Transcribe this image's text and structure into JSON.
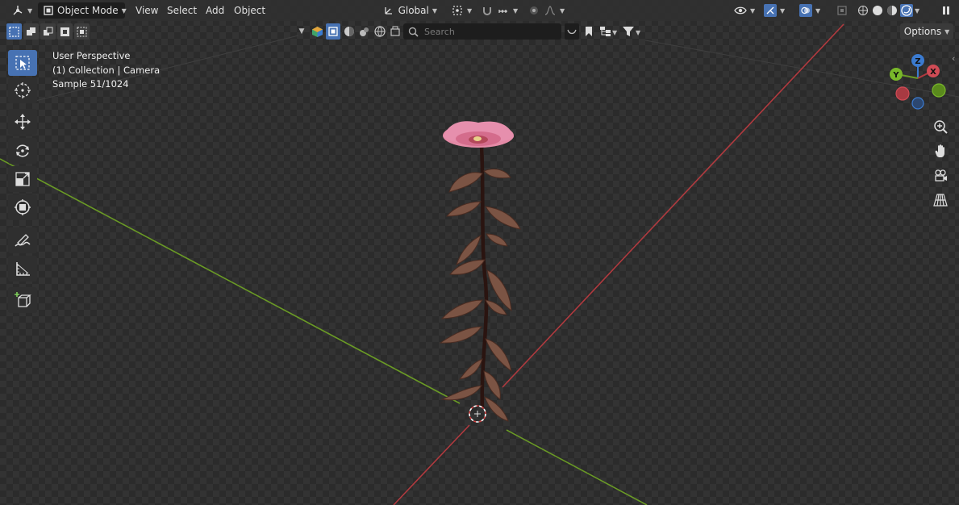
{
  "header": {
    "editor_type_icon": "3d-viewport-icon",
    "mode_label": "Object Mode",
    "menus": [
      "View",
      "Select",
      "Add",
      "Object"
    ],
    "transform_orientation": "Global"
  },
  "search": {
    "placeholder": "Search"
  },
  "options_label": "Options",
  "overlay": {
    "view_name": "User Perspective",
    "collection_info": "(1) Collection | Camera",
    "render_samples": "Sample 51/1024"
  },
  "gizmo": {
    "z_label": "Z",
    "y_label": "Y",
    "x_label": "X"
  },
  "toolbar": {
    "tools": [
      "select-box-icon",
      "cursor-icon",
      "move-icon",
      "rotate-icon",
      "scale-icon",
      "transform-icon",
      "annotate-icon",
      "measure-icon",
      "add-cube-icon"
    ],
    "active_tool": "select-box-icon"
  },
  "colors": {
    "accent": "#4772b3",
    "x_axis": "#b03a3f",
    "y_axis": "#6a9a25",
    "flower": "#e48aa6",
    "leaf": "#7b5444"
  }
}
